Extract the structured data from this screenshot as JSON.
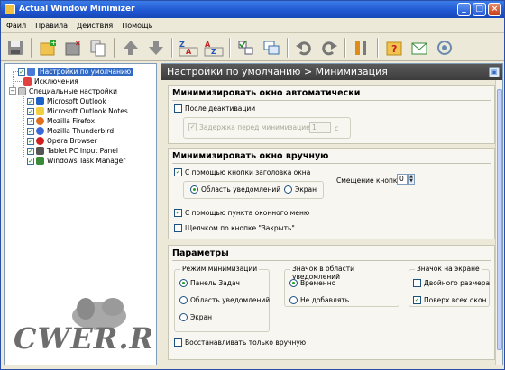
{
  "window": {
    "title": "Actual Window Minimizer"
  },
  "menu": [
    "Файл",
    "Правила",
    "Действия",
    "Помощь"
  ],
  "toolbar_icons": [
    "save-icon",
    "add-icon",
    "delete-icon",
    "copy-icon",
    "up-icon",
    "down-icon",
    "sort-az-icon",
    "sort-za-icon",
    "check-all-icon",
    "windows-icon",
    "undo-icon",
    "refresh-icon",
    "settings-icon",
    "help-icon",
    "email-icon",
    "support-icon"
  ],
  "tree": {
    "default": "Настройки по умолчанию",
    "exclusions": "Исключения",
    "special": "Специальные настройки",
    "apps": [
      "Microsoft Outlook",
      "Microsoft Outlook Notes",
      "Mozilla Firefox",
      "Mozilla Thunderbird",
      "Opera Browser",
      "Tablet PC Input Panel",
      "Windows Task Manager"
    ]
  },
  "header": {
    "title": "Настройки по умолчанию > Минимизация"
  },
  "auto": {
    "title": "Минимизировать окно автоматически",
    "after_deactivation": "После деактивации",
    "delay_label": "Задержка перед минимизацией",
    "delay_value": "1",
    "delay_unit": "с"
  },
  "manual": {
    "title": "Минимизировать окно вручную",
    "title_button": "С помощью кнопки заголовка окна",
    "tray": "Область уведомлений",
    "screen": "Экран",
    "offset_label": "Смещение кнопки",
    "offset_value": "0",
    "window_menu": "С помощью пункта оконного меню",
    "close_click": "Щелчком по кнопке \"Закрыть\""
  },
  "params": {
    "title": "Параметры",
    "mode_group": "Режим минимизации",
    "mode_taskbar": "Панель Задач",
    "mode_tray": "Область уведомлений",
    "mode_screen": "Экран",
    "icon_group": "Значок в области уведомлений",
    "icon_temp": "Временно",
    "icon_noadd": "Не добавлять",
    "screen_group": "Значок на экране",
    "double_size": "Двойного размера",
    "on_top": "Поверх всех окон",
    "restore_manual": "Восстанавливать только вручную"
  },
  "watermark": "CWER.RU"
}
